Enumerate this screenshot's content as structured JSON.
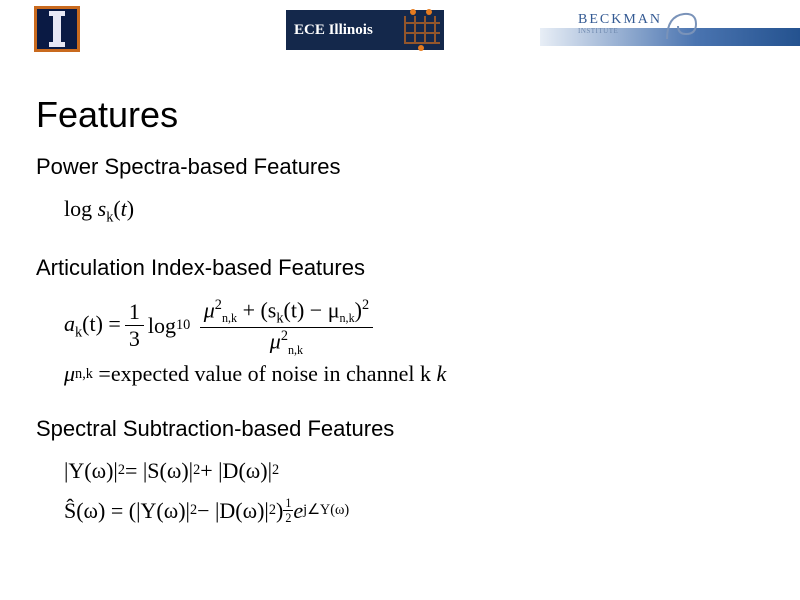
{
  "header": {
    "illinois_logo_alt": "University of Illinois block I logo",
    "ece_logo_text": "ECE Illinois",
    "beckman_logo_text": "BECKMAN",
    "beckman_logo_sub": "INSTITUTE"
  },
  "title": "Features",
  "sections": {
    "power": {
      "heading": "Power Spectra-based Features",
      "formula_plain": "log s_k(t)"
    },
    "articulation": {
      "heading": "Articulation Index-based Features",
      "formula_plain": "a_k(t) = (1/3) log10 [ (mu_{n,k}^2 + (s_k(t) - mu_{n,k})^2) / mu_{n,k}^2 ]",
      "mu_def_lhs": "μ_{n,k} =",
      "mu_def_rhs": "expected value of noise in channel k",
      "a_lhs": "a",
      "a_sub": "k",
      "a_arg": "(t) = ",
      "onethird_num": "1",
      "onethird_den": "3",
      "log10": " log",
      "log10_sub": "10",
      "num_mu": "μ",
      "num_mu_sub": "n,k",
      "num_plus": " + (s",
      "num_s_sub": "k",
      "num_s_arg": "(t) − μ",
      "num_tail": ")",
      "den_mu": "μ",
      "sq": "2"
    },
    "spectral": {
      "heading": "Spectral Subtraction-based Features",
      "formula1_plain": "|Y(ω)|^2 = |S(ω)|^2 + |D(ω)|^2",
      "formula2_plain": "Ŝ(ω) = ( |Y(ω)|^2 − |D(ω)|^2 )^{1/2} e^{j∠Y(ω)}",
      "f1_Y": "|Y(ω)|",
      "f1_eq": " = |S(ω)|",
      "f1_plus": " + |D(ω)|",
      "f2_S": "Ŝ(ω) = (|Y(ω)|",
      "f2_minus": " − |D(ω)|",
      "f2_close": ")",
      "half_num": "1",
      "half_den": "2",
      "f2_exp_e": "e",
      "f2_exp_pow": "j∠Y(ω)"
    }
  }
}
